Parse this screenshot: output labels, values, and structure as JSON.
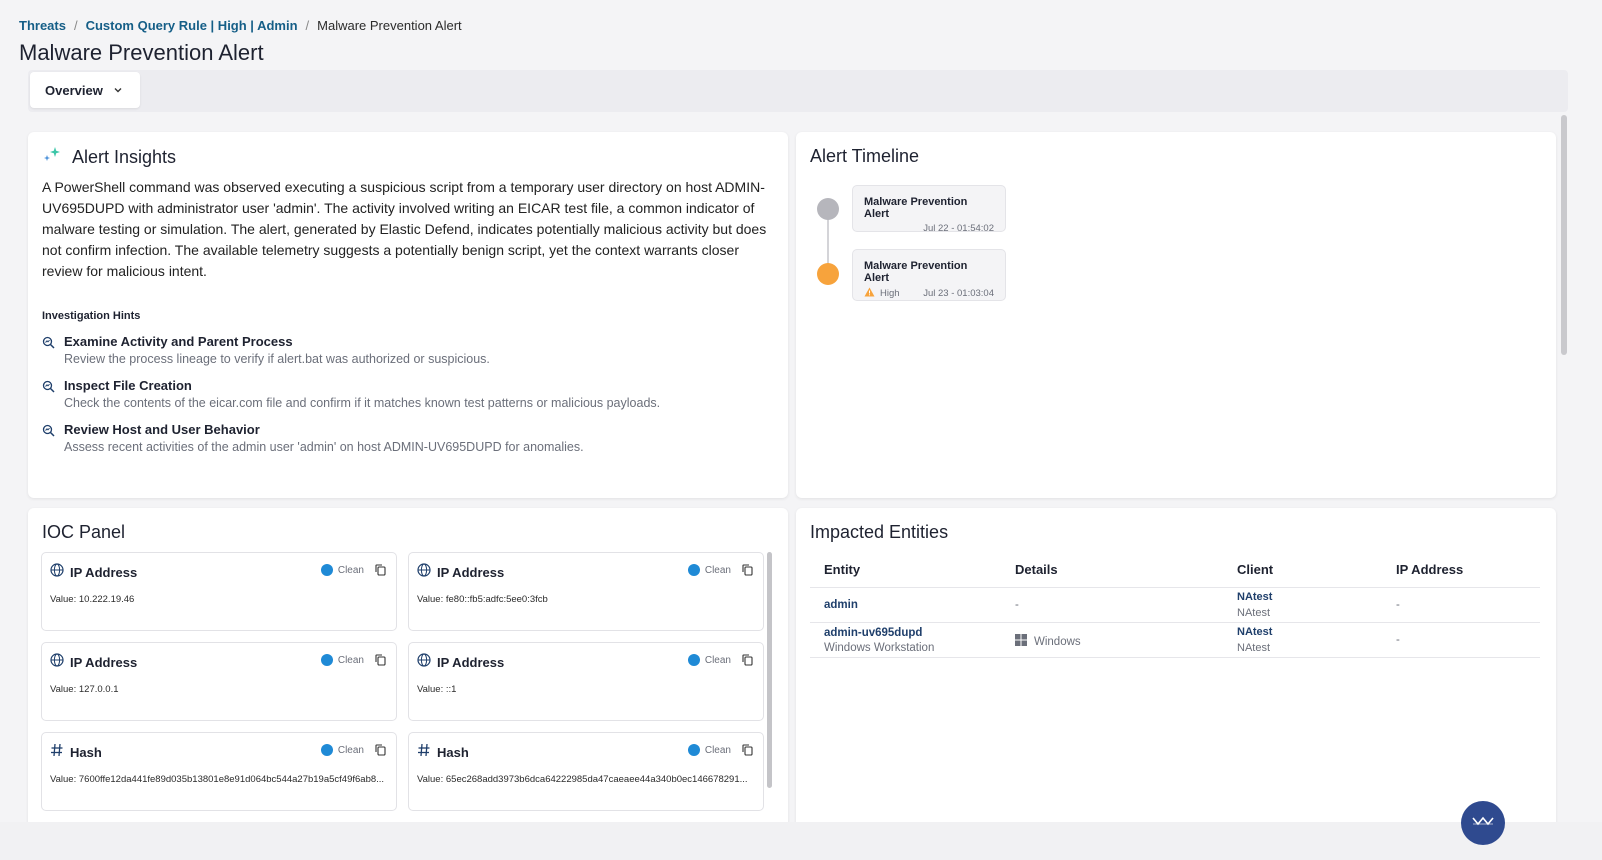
{
  "breadcrumb": {
    "items": [
      "Threats",
      "Custom Query Rule | High | Admin"
    ],
    "separator": "/",
    "current": "Malware Prevention Alert"
  },
  "page_title": "Malware Prevention Alert",
  "tabs": {
    "selected": "Overview"
  },
  "insights": {
    "title": "Alert Insights",
    "summary": "A PowerShell command was observed executing a suspicious script from a temporary user directory on host ADMIN-UV695DUPD with administrator user 'admin'. The activity involved writing an EICAR test file, a common indicator of malware testing or simulation. The alert, generated by Elastic Defend, indicates potentially malicious activity but does not confirm infection. The available telemetry suggests a potentially benign script, yet the context warrants closer review for malicious intent.",
    "hints_title": "Investigation Hints",
    "hints": [
      {
        "title": "Examine Activity and Parent Process",
        "desc": "Review the process lineage to verify if alert.bat was authorized or suspicious."
      },
      {
        "title": "Inspect File Creation",
        "desc": "Check the contents of the eicar.com file and confirm if it matches known test patterns or malicious payloads."
      },
      {
        "title": "Review Host and User Behavior",
        "desc": "Assess recent activities of the admin user 'admin' on host ADMIN-UV695DUPD for anomalies."
      }
    ]
  },
  "timeline": {
    "title": "Alert Timeline",
    "events": [
      {
        "name": "Malware Prevention Alert",
        "severity": "",
        "time": "Jul 22 - 01:54:02",
        "dot_color": "#b6b6bc"
      },
      {
        "name": "Malware Prevention Alert",
        "severity": "High",
        "time": "Jul 23 - 01:03:04",
        "dot_color": "#f7a33c"
      }
    ]
  },
  "ioc": {
    "title": "IOC Panel",
    "items": [
      {
        "type": "IP Address",
        "icon": "globe-icon",
        "status": "Clean",
        "value": "Value: 10.222.19.46"
      },
      {
        "type": "IP Address",
        "icon": "globe-icon",
        "status": "Clean",
        "value": "Value: fe80::fb5:adfc:5ee0:3fcb"
      },
      {
        "type": "IP Address",
        "icon": "globe-icon",
        "status": "Clean",
        "value": "Value: 127.0.0.1"
      },
      {
        "type": "IP Address",
        "icon": "globe-icon",
        "status": "Clean",
        "value": "Value: ::1"
      },
      {
        "type": "Hash",
        "icon": "hash-icon",
        "status": "Clean",
        "value": "Value: 7600ffe12da441fe89d035b13801e8e91d064bc544a27b19a5cf49f6ab8..."
      },
      {
        "type": "Hash",
        "icon": "hash-icon",
        "status": "Clean",
        "value": "Value: 65ec268add3973b6dca64222985da47caeaee44a340b0ec146678291..."
      }
    ],
    "status_color": "#1f8ad6"
  },
  "entities": {
    "title": "Impacted Entities",
    "columns": [
      "Entity",
      "Details",
      "Client",
      "IP Address"
    ],
    "rows": [
      {
        "entity": "admin",
        "entity_sub": "",
        "details": "-",
        "client": "NAtest",
        "client_sub": "NAtest",
        "ip": "-"
      },
      {
        "entity": "admin-uv695dupd",
        "entity_sub": "Windows Workstation",
        "details": "Windows",
        "client": "NAtest",
        "client_sub": "NAtest",
        "ip": "-"
      }
    ]
  },
  "colors": {
    "accent": "#155e87",
    "warning": "#f7a33c",
    "fab": "#2f4a8f"
  }
}
